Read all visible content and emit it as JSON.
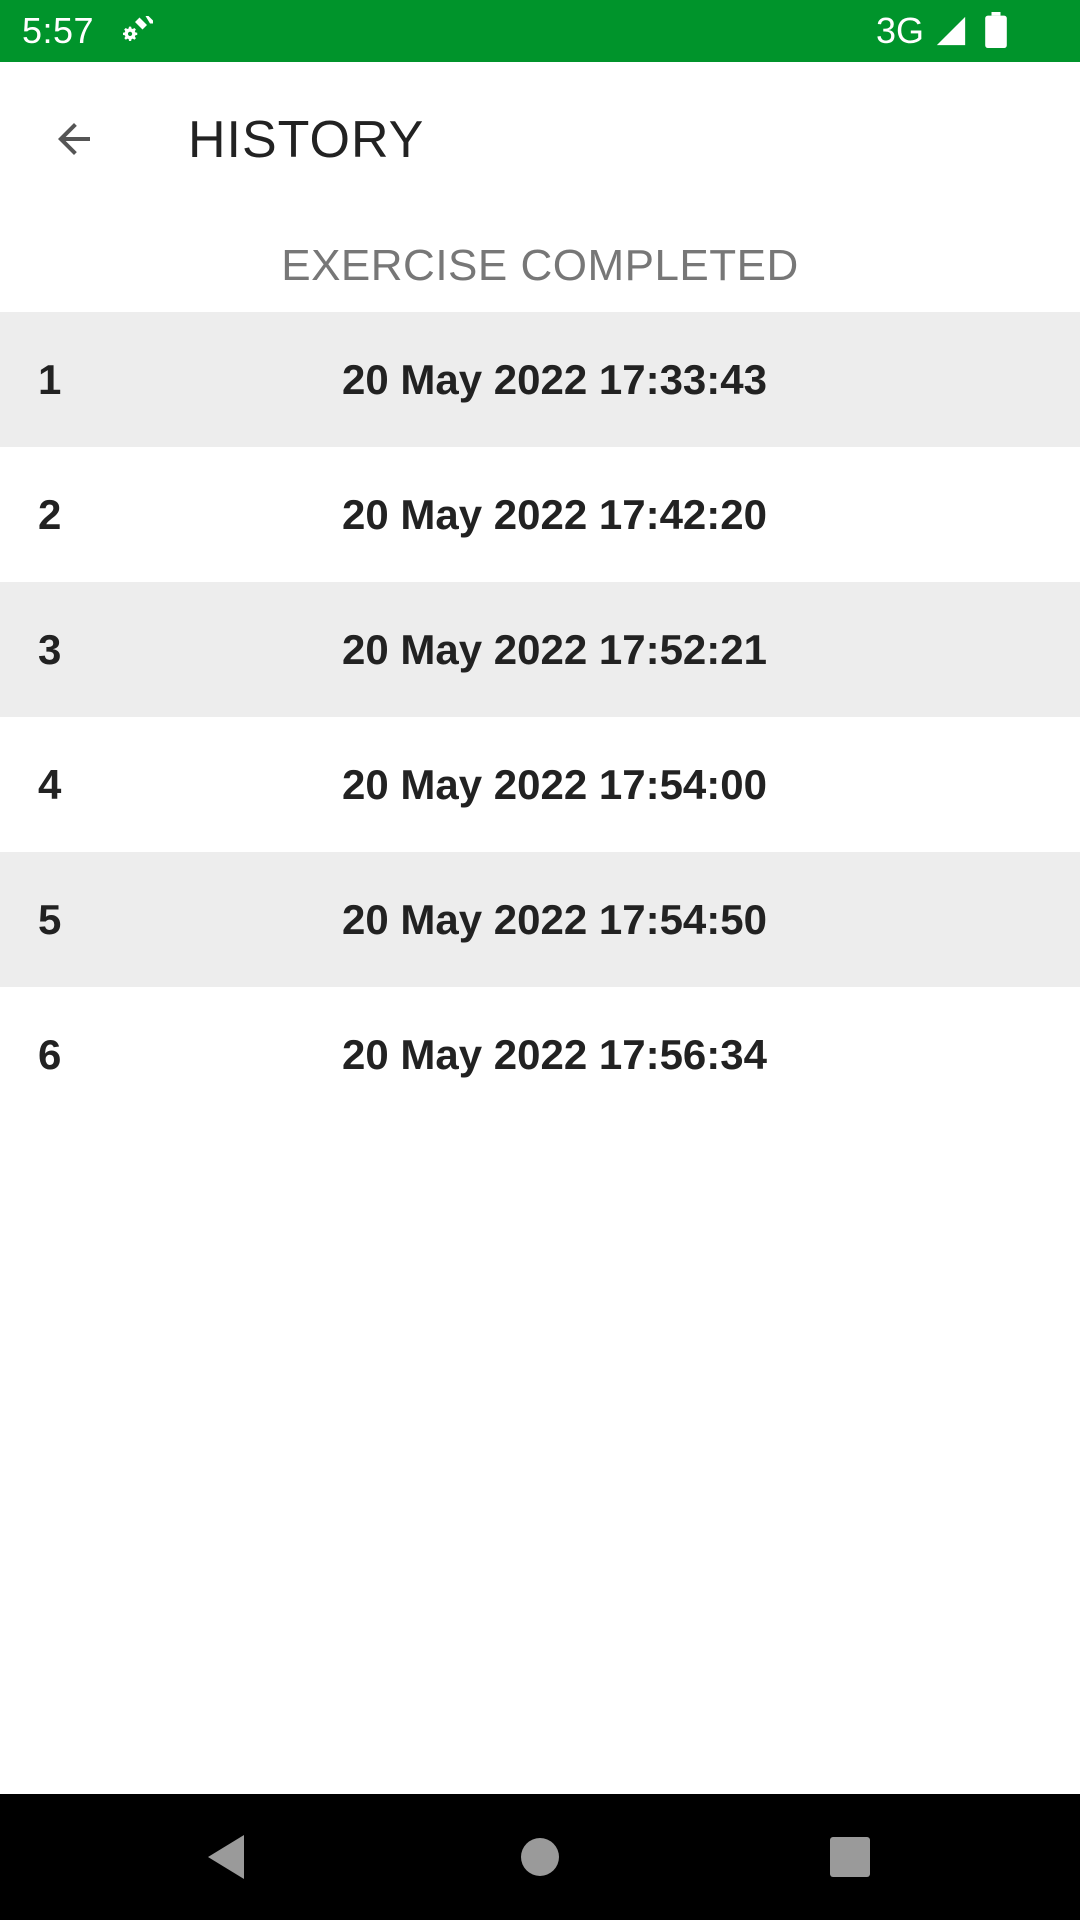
{
  "status_bar": {
    "time": "5:57",
    "network": "3G",
    "background_color": "#00942b",
    "icons": [
      "settings-gear-icon",
      "signal-icon",
      "battery-icon"
    ]
  },
  "app_bar": {
    "title": "HISTORY",
    "back_icon": "arrow-back-icon"
  },
  "section_header": "EXERCISE COMPLETED",
  "history": [
    {
      "index": "1",
      "date": "20 May 2022 17:33:43"
    },
    {
      "index": "2",
      "date": "20 May 2022 17:42:20"
    },
    {
      "index": "3",
      "date": "20 May 2022 17:52:21"
    },
    {
      "index": "4",
      "date": "20 May 2022 17:54:00"
    },
    {
      "index": "5",
      "date": "20 May 2022 17:54:50"
    },
    {
      "index": "6",
      "date": "20 May 2022 17:56:34"
    }
  ],
  "nav_bar": {
    "icons": [
      "nav-back-icon",
      "nav-home-icon",
      "nav-recents-icon"
    ]
  }
}
